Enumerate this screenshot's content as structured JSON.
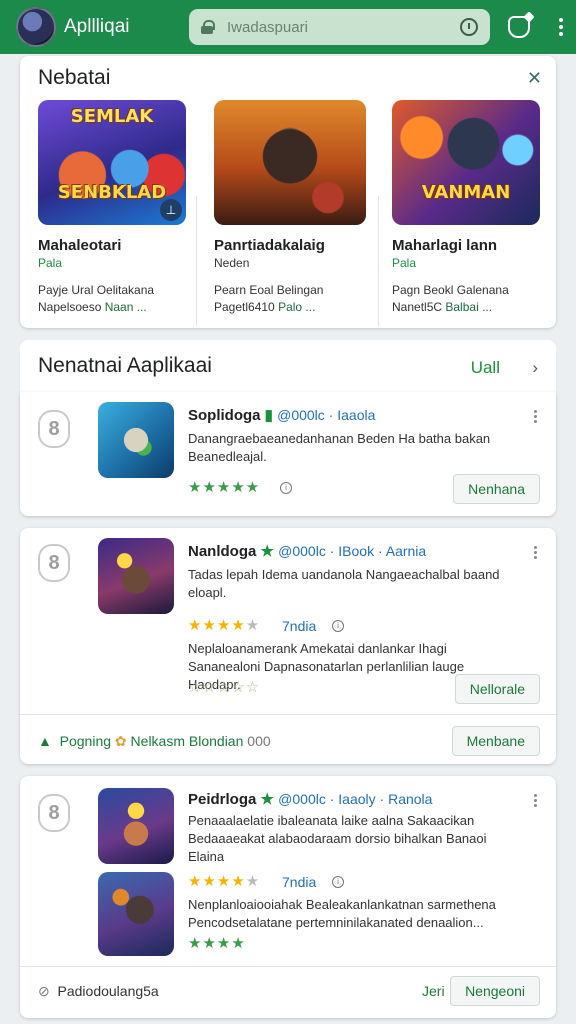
{
  "header": {
    "app_title": "Apllliqai",
    "search_placeholder": "Iwadaspuari",
    "bg_color": "#1b8a4b"
  },
  "featured": {
    "title": "Nebatai",
    "items": [
      {
        "name": "Mahaleotari",
        "sub": "Pala",
        "desc_line1": "Payje Ural Oelitakana",
        "desc_line2a": "Napelsoeso ",
        "desc_line2b": "Naan ...",
        "art_top": "SEMLAK",
        "art_bottom": "SENBKLAD"
      },
      {
        "name": "Panrtiadakalaig",
        "sub": "Neden",
        "desc_line1": "Pearn Eoal Belingan",
        "desc_line2a": "Pagetl6410 ",
        "desc_line2b": "Palo ...",
        "art_top": "",
        "art_bottom": ""
      },
      {
        "name": "Maharlagi lann",
        "sub": "Pala",
        "desc_line1": "Pagn Beokl Galenana",
        "desc_line2a": "Nanetl5C ",
        "desc_line2b": "Balbai ...",
        "art_top": "",
        "art_bottom": "VANMAN"
      }
    ]
  },
  "recommended": {
    "title": "Nenatnai Aaplikaai",
    "view_all": "Uall",
    "apps": [
      {
        "rank": "8",
        "name": "Soplidoga",
        "publisher": "@000lc · Iaaola",
        "desc": "Danangraebaeanedanhanan Beden Ha batha bakan Beanedleajal.",
        "stars": "★★★★★",
        "button": "Nenhana"
      },
      {
        "rank": "8",
        "name": "Nanldoga",
        "publisher": "@000lc · IBook · Aarnia",
        "desc": "Tadas lepah Idema uandanola Nangaeachalbal baand eloapl.",
        "stars_filled": "★★★★",
        "stars_empty": "★",
        "rating": "7ndia",
        "desc2": "Neplaloanamerank Amekatai danlankar Ihagi Sananealoni Dapnasonatarlan perlanlilian lauge Haodapr.",
        "stars2": "☆☆☆☆☆",
        "button": "Nellorale",
        "footer_text": "Pogning",
        "footer_link": "Nelkasm Blondian",
        "footer_count": "000",
        "footer_button": "Menbane"
      },
      {
        "rank": "8",
        "name": "Peidrloga",
        "publisher": "@000lc · Iaaoly · Ranola",
        "desc": "Penaaalaelatie ibaleanata laike aalna Sakaacikan Bedaaaeakat alabaodaraam dorsio bihalkan Banaoi Elaina",
        "stars_filled": "★★★★",
        "stars_empty": "★",
        "rating": "7ndia",
        "desc2": "Nenplanloaiooiahak Bealeakanlankatnan sarmethena Pencodsetalatane pertemninilakanated denaalion...",
        "stars2": "★★★★",
        "footer_text": "Padiodoulang5a",
        "footer_link": "Jeri",
        "footer_button": "Nengeoni"
      }
    ]
  }
}
